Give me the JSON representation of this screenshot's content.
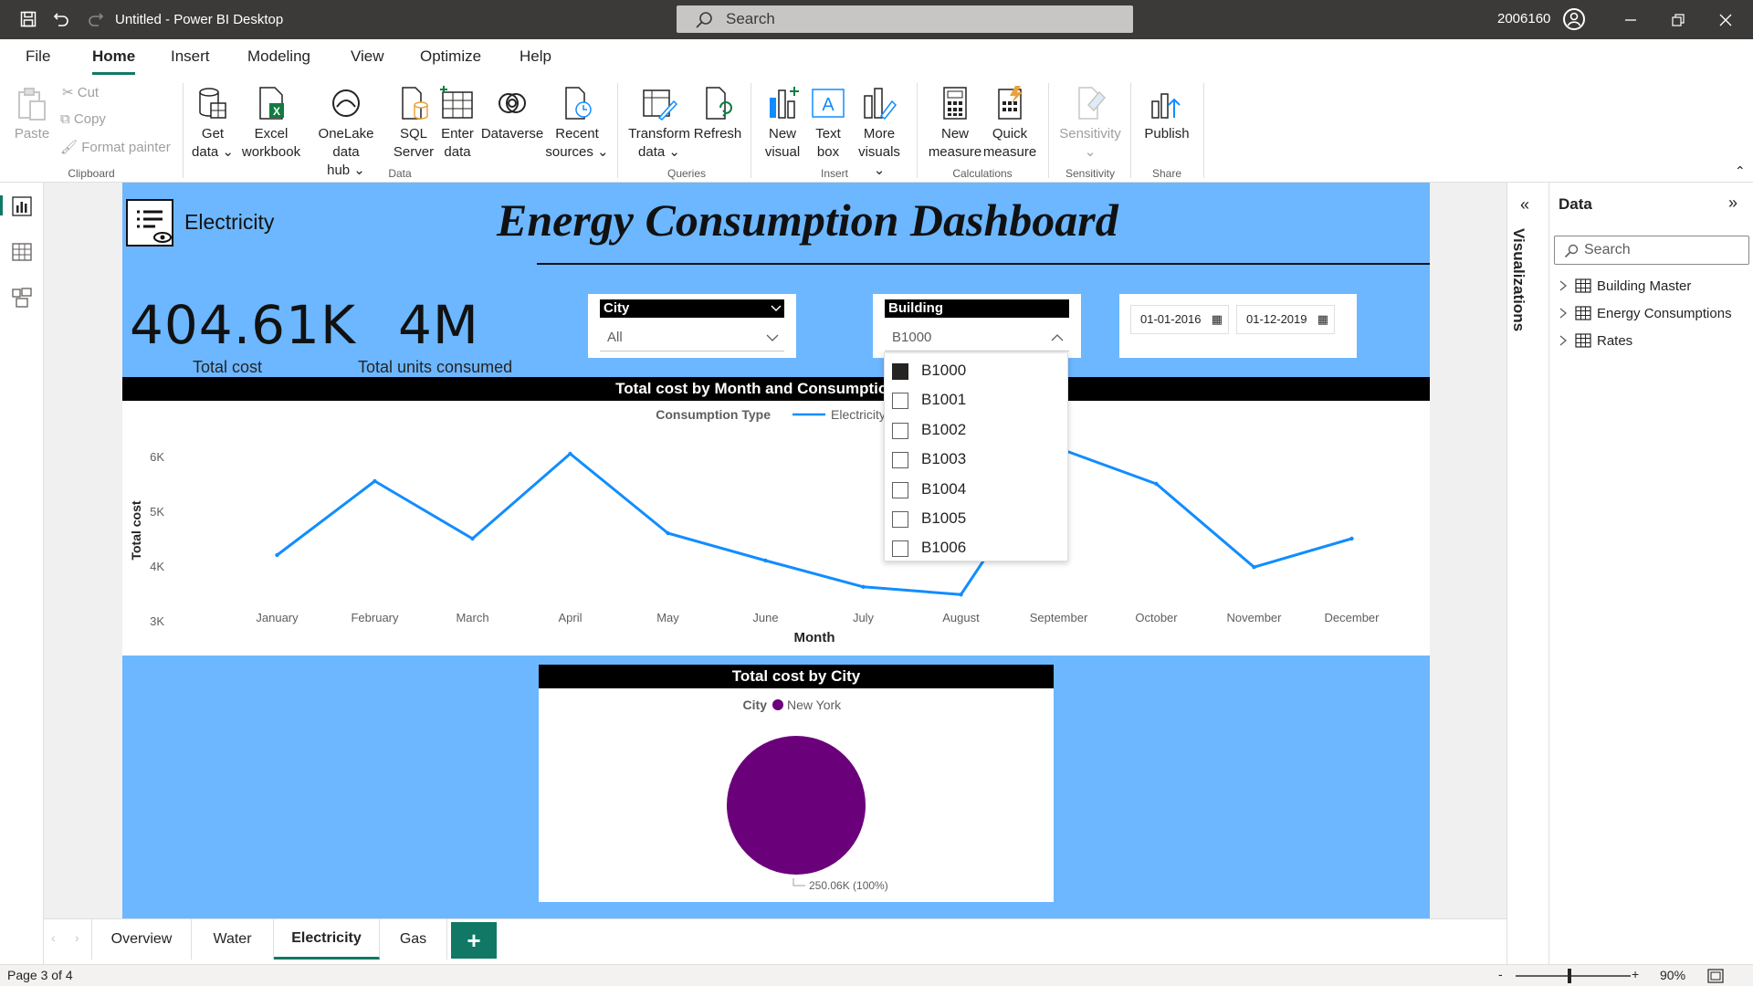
{
  "window": {
    "title": "Untitled - Power BI Desktop",
    "search_placeholder": "Search",
    "user_id": "2006160"
  },
  "menu": {
    "tabs": [
      "File",
      "Home",
      "Insert",
      "Modeling",
      "View",
      "Optimize",
      "Help"
    ],
    "active_tab": "Home"
  },
  "ribbon": {
    "clipboard": {
      "paste": "Paste",
      "cut": "Cut",
      "copy": "Copy",
      "format_painter": "Format painter",
      "group": "Clipboard"
    },
    "data": {
      "get_data": [
        "Get",
        "data"
      ],
      "excel": [
        "Excel",
        "workbook"
      ],
      "onelake": [
        "OneLake data",
        "hub"
      ],
      "sql": [
        "SQL",
        "Server"
      ],
      "enter": [
        "Enter",
        "data"
      ],
      "dataverse": "Dataverse",
      "recent": [
        "Recent",
        "sources"
      ],
      "group": "Data"
    },
    "queries": {
      "transform": [
        "Transform",
        "data"
      ],
      "refresh": "Refresh",
      "group": "Queries"
    },
    "insert": {
      "new_visual": [
        "New",
        "visual"
      ],
      "text_box": [
        "Text",
        "box"
      ],
      "more_visuals": [
        "More",
        "visuals"
      ],
      "group": "Insert"
    },
    "calculations": {
      "new_measure": [
        "New",
        "measure"
      ],
      "quick_measure": [
        "Quick",
        "measure"
      ],
      "group": "Calculations"
    },
    "sensitivity": {
      "label": "Sensitivity",
      "group": "Sensitivity"
    },
    "share": {
      "publish": "Publish",
      "group": "Share"
    }
  },
  "report": {
    "section_label": "Electricity",
    "title": "Energy Consumption Dashboard",
    "kpis": [
      {
        "value": "404.61K",
        "label": "Total cost"
      },
      {
        "value": "4M",
        "label": "Total units consumed"
      }
    ],
    "city_slicer": {
      "header": "City",
      "value": "All"
    },
    "building_slicer": {
      "header": "Building",
      "value": "B1000"
    },
    "date_range": {
      "start": "01-01-2016",
      "end": "01-12-2019"
    },
    "building_dropdown": [
      {
        "label": "B1000",
        "checked": true
      },
      {
        "label": "B1001",
        "checked": false
      },
      {
        "label": "B1002",
        "checked": false
      },
      {
        "label": "B1003",
        "checked": false
      },
      {
        "label": "B1004",
        "checked": false
      },
      {
        "label": "B1005",
        "checked": false
      },
      {
        "label": "B1006",
        "checked": false
      }
    ]
  },
  "chart_data": [
    {
      "type": "line",
      "title": "Total cost by Month and Consumption Type",
      "xlabel": "Month",
      "ylabel": "Total cost",
      "legend_title": "Consumption Type",
      "legend_placement": "top-center",
      "categories": [
        "January",
        "February",
        "March",
        "April",
        "May",
        "June",
        "July",
        "August",
        "September",
        "October",
        "November",
        "December"
      ],
      "series": [
        {
          "name": "Electricity",
          "color": "#118dff",
          "values": [
            4200,
            5550,
            4500,
            6050,
            4600,
            4100,
            3620,
            3480,
            6150,
            5500,
            3980,
            4500
          ]
        }
      ],
      "yticks": [
        "3K",
        "4K",
        "5K",
        "6K"
      ],
      "ytick_values": [
        3000,
        4000,
        5000,
        6000
      ],
      "ylim": [
        2950,
        6350
      ],
      "grid": false
    },
    {
      "type": "pie",
      "title": "Total cost by City",
      "legend_title": "City",
      "legend_placement": "top-center",
      "slices": [
        {
          "name": "New York",
          "value": 250060,
          "label": "250.06K (100%)",
          "color": "#6b007b"
        }
      ]
    }
  ],
  "page_tabs": {
    "tabs": [
      "Overview",
      "Water",
      "Electricity",
      "Gas"
    ],
    "active": "Electricity",
    "add": "+"
  },
  "status": {
    "page": "Page 3 of 4",
    "zoom": "90%",
    "zoom_minus": "-",
    "zoom_plus": "+"
  },
  "panes": {
    "visualizations": "Visualizations",
    "data": {
      "title": "Data",
      "search_placeholder": "Search",
      "tables": [
        "Building Master",
        "Energy Consumptions",
        "Rates"
      ]
    }
  },
  "icons": {
    "save": "save-icon",
    "undo": "undo-icon",
    "redo": "redo-icon",
    "report_view": "report-view-icon",
    "table_view": "table-view-icon",
    "model_view": "model-view-icon"
  }
}
